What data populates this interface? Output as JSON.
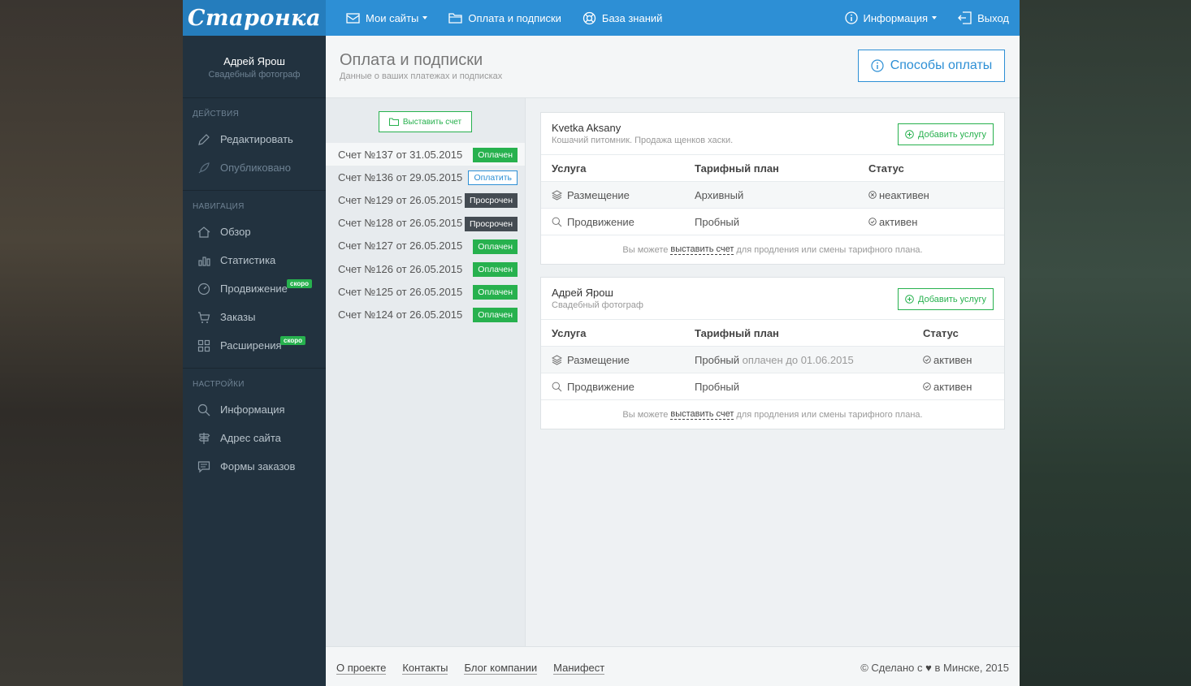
{
  "brand": {
    "logo_text": "Старонка"
  },
  "topnav": {
    "my_sites": "Мои сайты",
    "billing": "Оплата и подписки",
    "knowledge": "База знаний",
    "info": "Информация",
    "logout": "Выход"
  },
  "sidebar": {
    "user_name": "Адрей Ярош",
    "user_role": "Свадебный фотограф",
    "sections": {
      "actions": {
        "title": "Действия",
        "edit": "Редактировать",
        "published": "Опубликовано"
      },
      "navigation": {
        "title": "Навигация",
        "overview": "Обзор",
        "stats": "Статистика",
        "promotion": "Продвижение",
        "orders": "Заказы",
        "extensions": "Расширения",
        "soon": "скоро"
      },
      "settings": {
        "title": "Настройки",
        "info": "Информация",
        "address": "Адрес сайта",
        "forms": "Формы заказов"
      }
    }
  },
  "header": {
    "title": "Оплата и подписки",
    "subtitle": "Данные о ваших платежах и подписках",
    "pay_methods_button": "Способы оплаты"
  },
  "invoices": {
    "create_button": "Выставить счет",
    "items": [
      {
        "label": "Счет №137 от 31.05.2015",
        "status": "Оплачен",
        "kind": "paid"
      },
      {
        "label": "Счет №136 от 29.05.2015",
        "status": "Оплатить",
        "kind": "pay"
      },
      {
        "label": "Счет №129 от 26.05.2015",
        "status": "Просрочен",
        "kind": "overdue"
      },
      {
        "label": "Счет №128 от 26.05.2015",
        "status": "Просрочен",
        "kind": "overdue"
      },
      {
        "label": "Счет №127 от 26.05.2015",
        "status": "Оплачен",
        "kind": "paid"
      },
      {
        "label": "Счет №126 от 26.05.2015",
        "status": "Оплачен",
        "kind": "paid"
      },
      {
        "label": "Счет №125 от 26.05.2015",
        "status": "Оплачен",
        "kind": "paid"
      },
      {
        "label": "Счет №124 от 26.05.2015",
        "status": "Оплачен",
        "kind": "paid"
      }
    ]
  },
  "cards": [
    {
      "name": "Kvetka Aksany",
      "desc": "Кошачий питомник. Продажа щенков хаски.",
      "add_button": "Добавить услугу",
      "headers": {
        "service": "Услуга",
        "plan": "Тарифный план",
        "status": "Статус"
      },
      "rows": [
        {
          "service": "Размещение",
          "plan": "Архивный",
          "plan_note": "",
          "status": "неактивен"
        },
        {
          "service": "Продвижение",
          "plan": "Пробный",
          "plan_note": "",
          "status": "активен"
        }
      ],
      "foot_before": "Вы можете",
      "foot_link": "выставить счет",
      "foot_after": "для продления или смены тарифного плана."
    },
    {
      "name": "Адрей Ярош",
      "desc": "Свадебный фотограф",
      "add_button": "Добавить услугу",
      "headers": {
        "service": "Услуга",
        "plan": "Тарифный план",
        "status": "Статус"
      },
      "rows": [
        {
          "service": "Размещение",
          "plan": "Пробный",
          "plan_note": "оплачен до 01.06.2015",
          "status": "активен"
        },
        {
          "service": "Продвижение",
          "plan": "Пробный",
          "plan_note": "",
          "status": "активен"
        }
      ],
      "foot_before": "Вы можете",
      "foot_link": "выставить счет",
      "foot_after": "для продления или смены тарифного плана."
    }
  ],
  "footer": {
    "links": [
      "О проекте",
      "Контакты",
      "Блог компании",
      "Манифест"
    ],
    "copy_before": "© Сделано с",
    "copy_after": "в Минске, 2015"
  },
  "colors": {
    "primary": "#2d8fd5",
    "success": "#27b14e",
    "sidebar": "#22323f",
    "overdue": "#444b52"
  }
}
